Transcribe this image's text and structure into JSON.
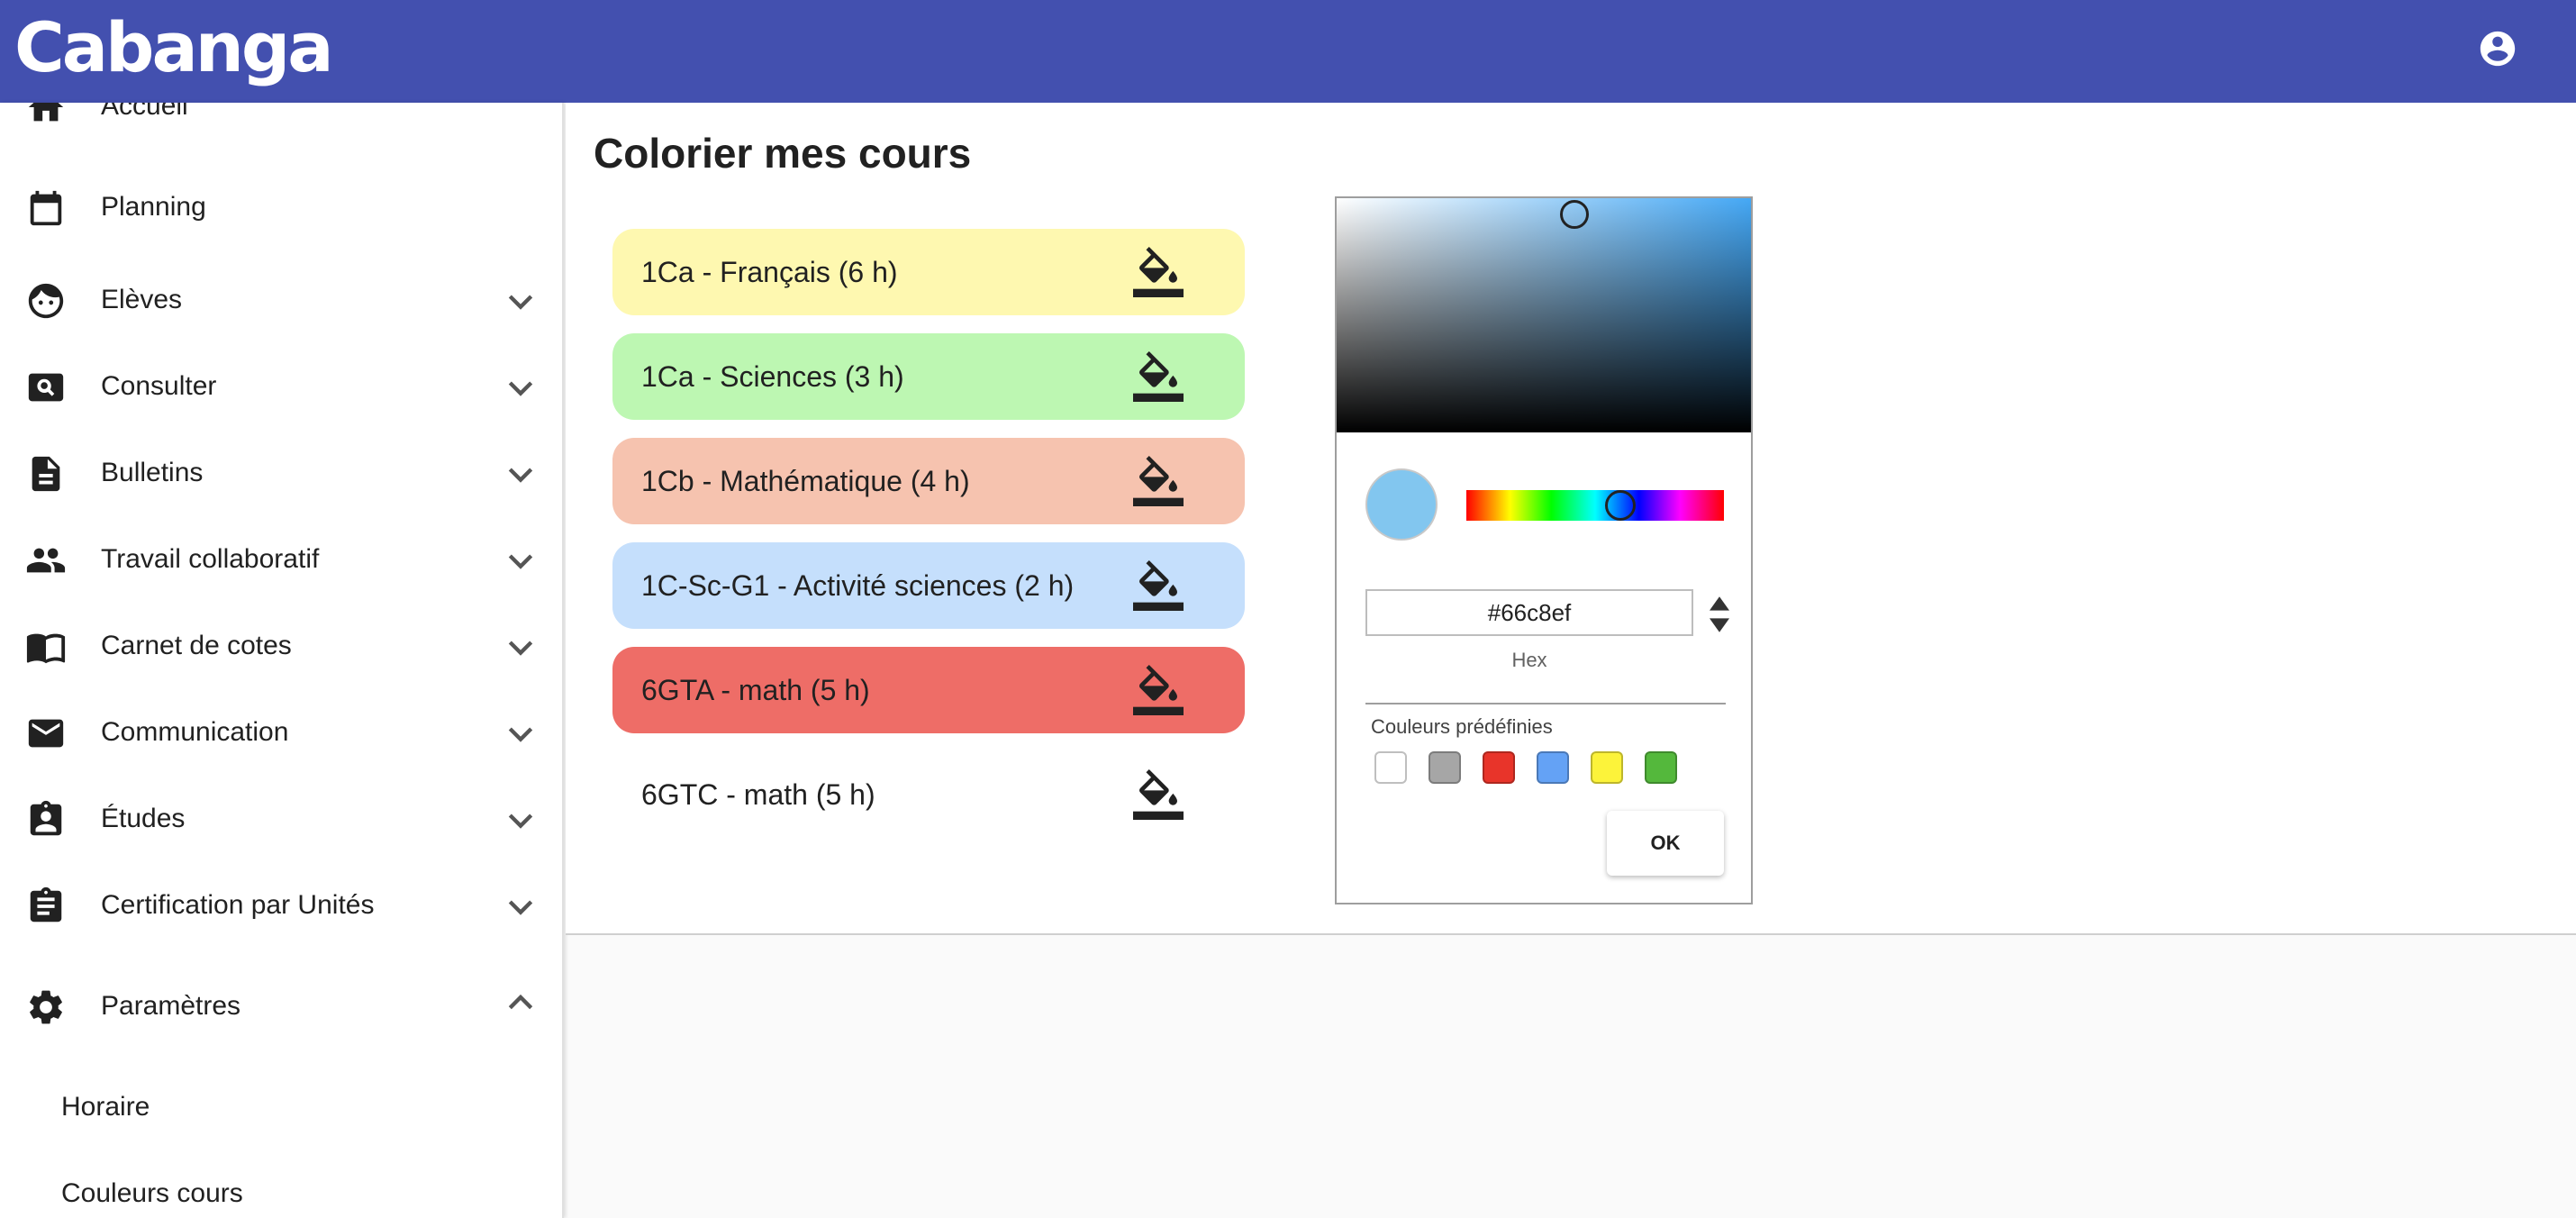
{
  "app": {
    "logo": "Cabanga"
  },
  "sidebar": {
    "items": [
      {
        "label": "Accueil",
        "icon": "home-icon",
        "expandable": false
      },
      {
        "label": "Planning",
        "icon": "calendar-icon",
        "expandable": false
      },
      {
        "label": "Elèves",
        "icon": "face-icon",
        "expandable": true
      },
      {
        "label": "Consulter",
        "icon": "search-box-icon",
        "expandable": true
      },
      {
        "label": "Bulletins",
        "icon": "document-icon",
        "expandable": true
      },
      {
        "label": "Travail collaboratif",
        "icon": "people-icon",
        "expandable": true
      },
      {
        "label": "Carnet de cotes",
        "icon": "book-icon",
        "expandable": true
      },
      {
        "label": "Communication",
        "icon": "mail-icon",
        "expandable": true
      },
      {
        "label": "Études",
        "icon": "badge-icon",
        "expandable": true
      },
      {
        "label": "Certification par Unités",
        "icon": "clipboard-icon",
        "expandable": true
      },
      {
        "label": "Paramètres",
        "icon": "gear-icon",
        "expandable": true,
        "expanded": true
      }
    ],
    "subitems": [
      {
        "label": "Horaire"
      },
      {
        "label": "Couleurs cours"
      }
    ]
  },
  "main": {
    "title": "Colorier mes cours",
    "courses": [
      {
        "name": "1Ca - Français (6 h)",
        "color": "#fef8b0"
      },
      {
        "name": "1Ca - Sciences (3 h)",
        "color": "#bdf7b2"
      },
      {
        "name": "1Cb - Mathématique (4 h)",
        "color": "#f6c3af"
      },
      {
        "name": "1C-Sc-G1 - Activité sciences (2 h)",
        "color": "#c5dffc"
      },
      {
        "name": "6GTA - math (5 h)",
        "color": "#ee6d67"
      },
      {
        "name": "6GTC - math (5 h)",
        "color": "#ffffff"
      }
    ]
  },
  "picker": {
    "current_color": "#82c6ef",
    "hex_value": "#66c8ef",
    "hex_label": "Hex",
    "preset_title": "Couleurs prédéfinies",
    "presets": [
      "#ffffff",
      "#a6a6a6",
      "#e8342a",
      "#64a2f5",
      "#fcf33a",
      "#54b83c"
    ],
    "ok_label": "OK"
  },
  "colors": {
    "appbar": "#4350af"
  }
}
